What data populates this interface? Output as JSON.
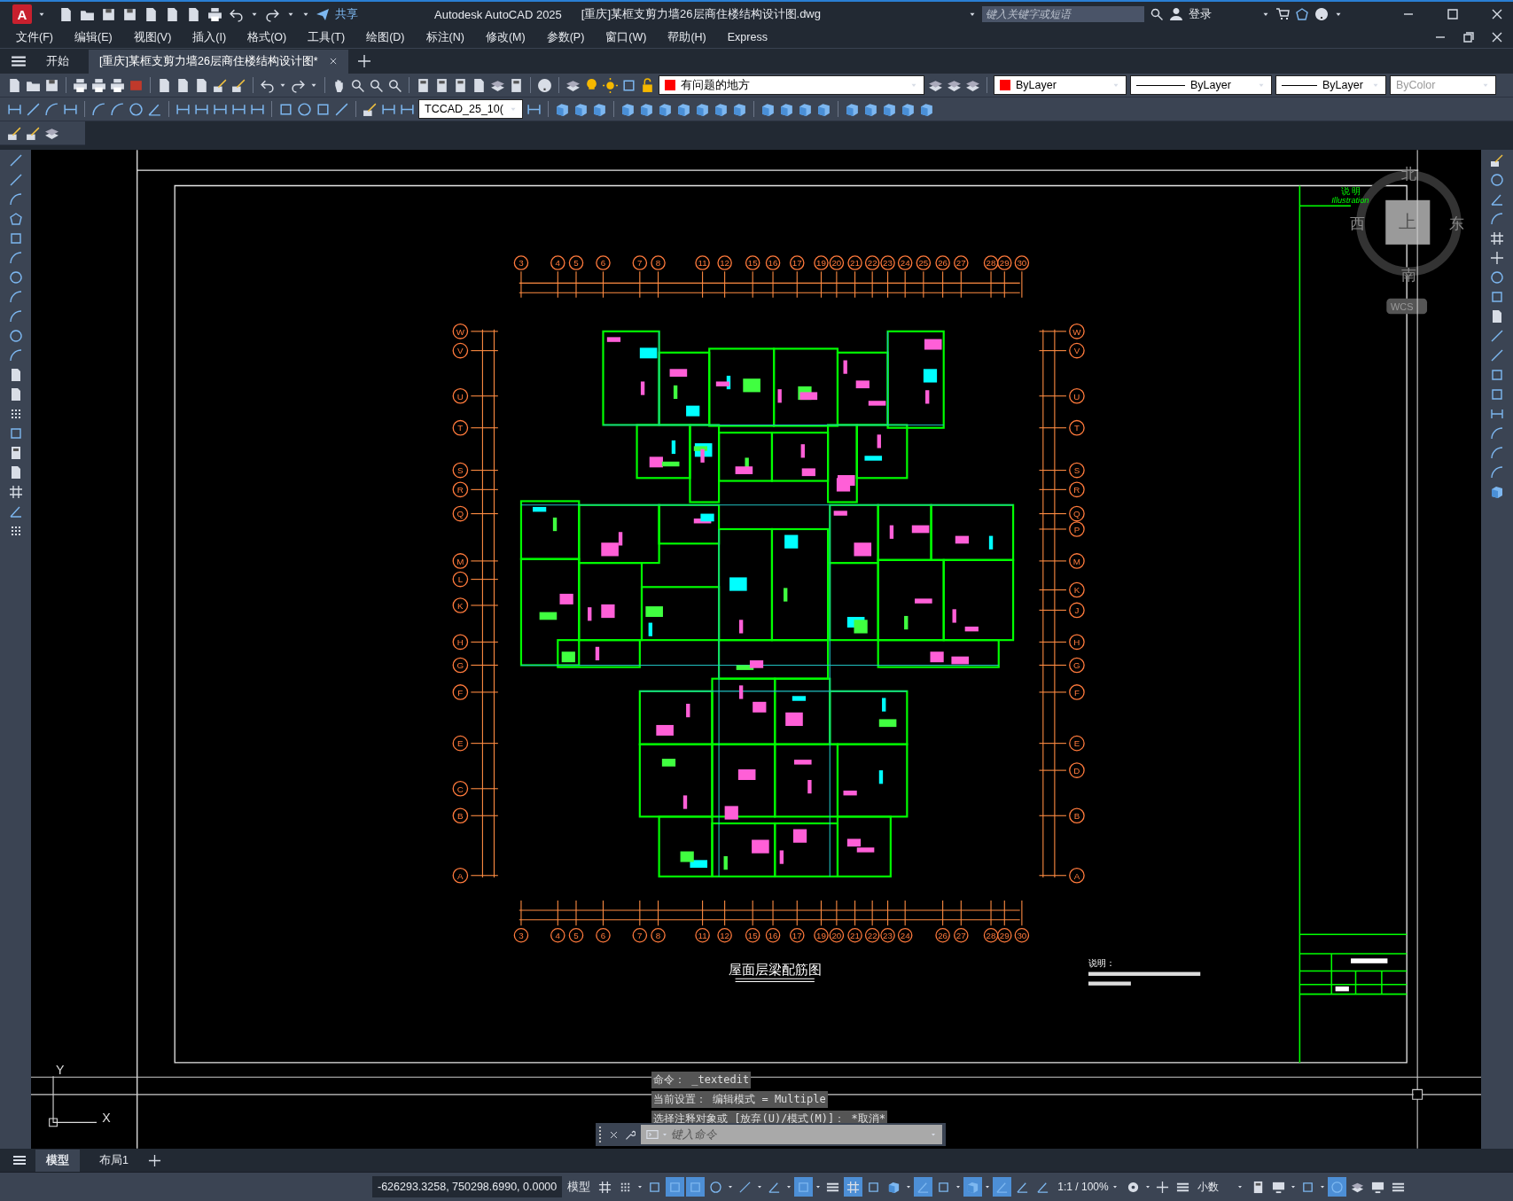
{
  "title_bar": {
    "logo": "A",
    "share": "共享",
    "app_title": "Autodesk AutoCAD 2025",
    "document_title": "[重庆]某框支剪力墙26层商住楼结构设计图.dwg",
    "search": {
      "placeholder": "键入关键字或短语"
    },
    "sign_in": "登录"
  },
  "menu": [
    "文件(F)",
    "编辑(E)",
    "视图(V)",
    "插入(I)",
    "格式(O)",
    "工具(T)",
    "绘图(D)",
    "标注(N)",
    "修改(M)",
    "参数(P)",
    "窗口(W)",
    "帮助(H)",
    "Express"
  ],
  "tabs": [
    {
      "label": "开始",
      "selected": false
    },
    {
      "label": "[重庆]某框支剪力墙26层商住楼结构设计图*",
      "selected": true
    }
  ],
  "toolbar": {
    "layer": "有问题的地方",
    "color_setting": "ByLayer",
    "linetype": "ByLayer",
    "lineweight": "ByLayer",
    "plot_style": {
      "label": "ByColor",
      "disabled": true
    },
    "dim_style": "TCCAD_25_10("
  },
  "drawing": {
    "title": "屋面层梁配筋图",
    "top_axes": [
      "3",
      "4",
      "5",
      "6",
      "7",
      "8",
      "11",
      "12",
      "15",
      "16",
      "17",
      "19",
      "20",
      "21",
      "22",
      "23",
      "24",
      "25",
      "26",
      "27",
      "28",
      "29",
      "30"
    ],
    "bottom_axes": [
      "3",
      "4",
      "5",
      "6",
      "7",
      "8",
      "11",
      "12",
      "15",
      "16",
      "17",
      "19",
      "20",
      "21",
      "22",
      "23",
      "24",
      "26",
      "27",
      "28",
      "29",
      "30"
    ],
    "left_axes": [
      "W",
      "V",
      "U",
      "T",
      "S",
      "R",
      "Q",
      "M",
      "L",
      "K",
      "H",
      "G",
      "F",
      "E",
      "C",
      "B",
      "A"
    ],
    "right_axes": [
      "W",
      "V",
      "U",
      "T",
      "S",
      "R",
      "Q",
      "P",
      "M",
      "K",
      "J",
      "H",
      "G",
      "F",
      "E",
      "D",
      "B",
      "A"
    ],
    "notes_heading": "说明：",
    "title_block": {
      "heading": "说 明",
      "subheading": "Illustration"
    }
  },
  "view_cube": {
    "north": "北",
    "south": "南",
    "west": "西",
    "east": "东",
    "face": "上",
    "ucs": "WCS"
  },
  "ucs_icon": {
    "x": "X",
    "y": "Y"
  },
  "command_line": {
    "history": [
      "命令： _textedit",
      "当前设置： 编辑模式 = Multiple",
      "选择注释对象或 [放弃(U)/模式(M)]： *取消*"
    ],
    "placeholder": "键入命令"
  },
  "layout_tabs": [
    {
      "label": "模型",
      "selected": true
    },
    {
      "label": "布局1",
      "selected": false
    }
  ],
  "status_bar": {
    "coordinates": "-626293.3258, 750298.6990, 0.0000",
    "space": "模型",
    "scale": "1:1 / 100%",
    "units": "小数",
    "toggles": [
      {
        "on": false
      },
      {
        "on": false
      },
      {
        "on": false
      },
      {
        "on": true
      },
      {
        "on": true
      },
      {
        "on": false
      },
      {
        "on": false
      },
      {
        "on": false
      },
      {
        "on": true
      },
      {
        "on": false
      },
      {
        "on": true
      },
      {
        "on": false
      },
      {
        "on": false
      },
      {
        "on": true
      },
      {
        "on": false
      },
      {
        "on": true
      },
      {
        "on": true
      },
      {
        "on": false
      },
      {
        "on": false
      },
      {
        "on": false
      },
      {
        "on": false
      },
      {
        "on": false
      },
      {
        "on": false
      },
      {
        "on": false
      },
      {
        "on": false
      },
      {
        "on": true
      },
      {
        "on": false
      },
      {
        "on": false
      },
      {
        "on": false
      }
    ]
  }
}
